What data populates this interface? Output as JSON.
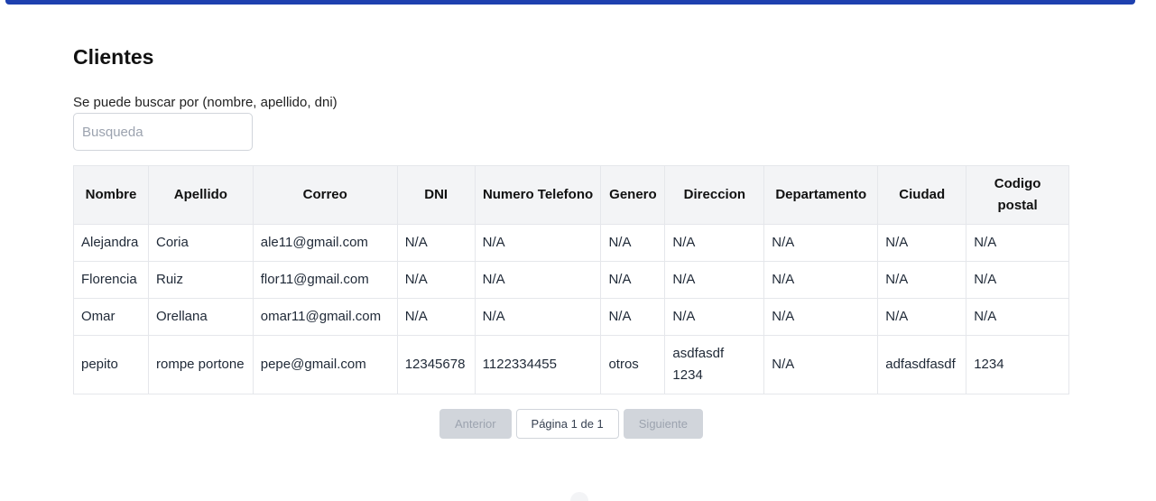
{
  "page": {
    "title": "Clientes",
    "search_label": "Se puede buscar por (nombre, apellido, dni)",
    "search_placeholder": "Busqueda",
    "search_value": ""
  },
  "table": {
    "headers": [
      "Nombre",
      "Apellido",
      "Correo",
      "DNI",
      "Numero Telefono",
      "Genero",
      "Direccion",
      "Departamento",
      "Ciudad",
      "Codigo postal"
    ],
    "rows": [
      [
        "Alejandra",
        "Coria",
        "ale11@gmail.com",
        "N/A",
        "N/A",
        "N/A",
        "N/A",
        "N/A",
        "N/A",
        "N/A"
      ],
      [
        "Florencia",
        "Ruiz",
        "flor11@gmail.com",
        "N/A",
        "N/A",
        "N/A",
        "N/A",
        "N/A",
        "N/A",
        "N/A"
      ],
      [
        "Omar",
        "Orellana",
        "omar11@gmail.com",
        "N/A",
        "N/A",
        "N/A",
        "N/A",
        "N/A",
        "N/A",
        "N/A"
      ],
      [
        "pepito",
        "rompe portone",
        "pepe@gmail.com",
        "12345678",
        "1122334455",
        "otros",
        "asdfasdf 1234",
        "N/A",
        "adfasdfasdf",
        "1234"
      ]
    ]
  },
  "pagination": {
    "prev_label": "Anterior",
    "page_label": "Página 1 de 1",
    "next_label": "Siguiente"
  },
  "colors": {
    "accent": "#1e40af",
    "header_bg": "#f3f4f6",
    "disabled_button": "#d1d5db"
  }
}
